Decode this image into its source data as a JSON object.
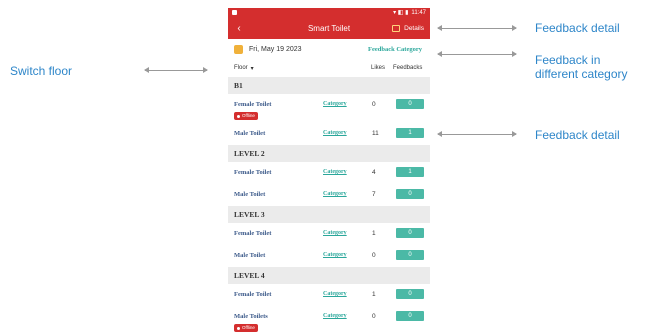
{
  "app": {
    "title": "Smart Toilet",
    "back_glyph": "‹",
    "details_label": "Details",
    "status_time": "11:47",
    "status_icons": "▾ ◧ ▮"
  },
  "header": {
    "date": "Fri, May 19 2023",
    "feedback_category": "Feedback Category"
  },
  "table_header": {
    "floor": "Floor",
    "floor_caret": "▾",
    "likes": "Likes",
    "feedbacks": "Feedbacks"
  },
  "levels": [
    {
      "name": "B1",
      "rows": [
        {
          "name": "Female Toilet",
          "category": "Category",
          "likes": "0",
          "feedbacks": "0",
          "offline": "Offline"
        },
        {
          "name": "Male Toilet",
          "category": "Category",
          "likes": "11",
          "feedbacks": "1"
        }
      ]
    },
    {
      "name": "LEVEL 2",
      "rows": [
        {
          "name": "Female Toilet",
          "category": "Category",
          "likes": "4",
          "feedbacks": "1"
        },
        {
          "name": "Male Toilet",
          "category": "Category",
          "likes": "7",
          "feedbacks": "0"
        }
      ]
    },
    {
      "name": "LEVEL 3",
      "rows": [
        {
          "name": "Female Toilet",
          "category": "Category",
          "likes": "1",
          "feedbacks": "0"
        },
        {
          "name": "Male Toilet",
          "category": "Category",
          "likes": "0",
          "feedbacks": "0"
        }
      ]
    },
    {
      "name": "LEVEL 4",
      "rows": [
        {
          "name": "Female Toilet",
          "category": "Category",
          "likes": "1",
          "feedbacks": "0"
        },
        {
          "name": "Male Toilets",
          "category": "Category",
          "likes": "0",
          "feedbacks": "0",
          "offline": "Offline"
        }
      ]
    }
  ],
  "annotations": {
    "switch_floor": "Switch floor",
    "feedback_detail_top": "Feedback detail",
    "feedback_category": "Feedback in different category",
    "feedback_detail_row": "Feedback detail"
  },
  "colors": {
    "brand_red": "#d42e2e",
    "accent_teal": "#4bb9a6",
    "annotation_blue": "#2e86c9"
  }
}
